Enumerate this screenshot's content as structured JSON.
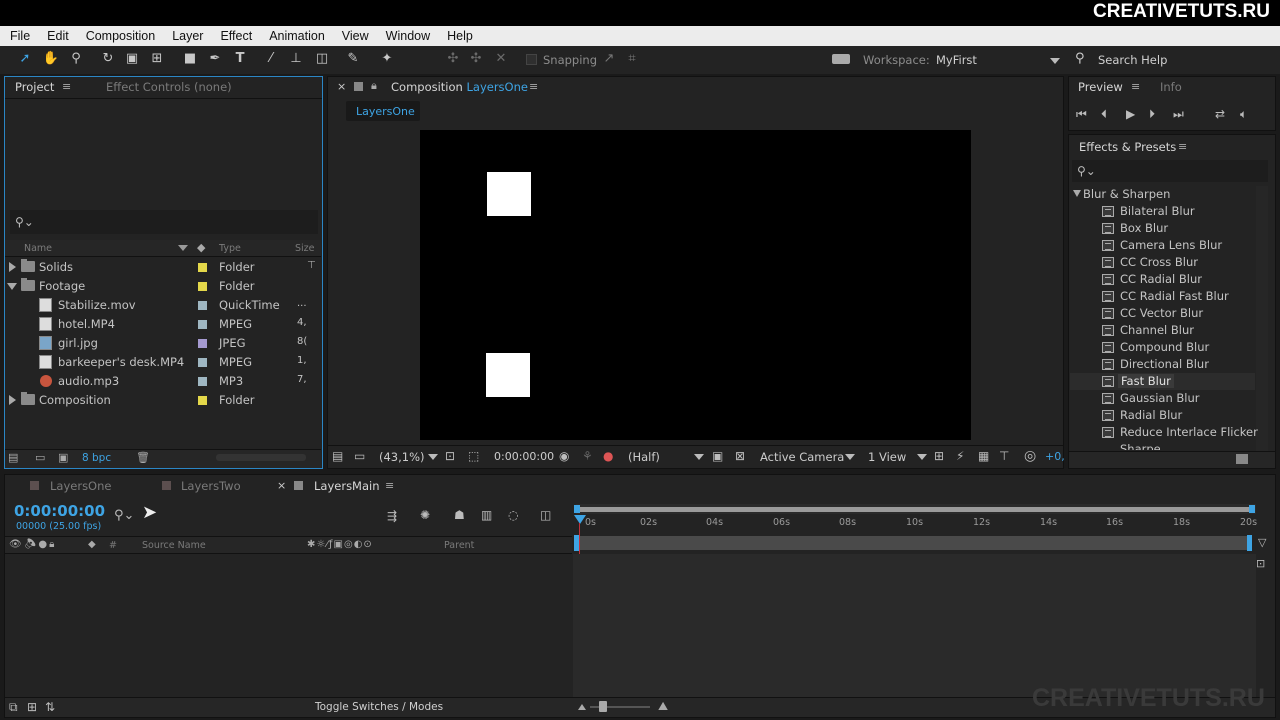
{
  "brand": "CREATIVETUTS.RU",
  "watermark": "CREATIVETUTS.RU",
  "menu": [
    "File",
    "Edit",
    "Composition",
    "Layer",
    "Effect",
    "Animation",
    "View",
    "Window",
    "Help"
  ],
  "toolbar": {
    "snapping": "Snapping",
    "workspace_label": "Workspace:",
    "workspace_value": "MyFirst",
    "search_help": "Search Help"
  },
  "project_panel": {
    "tab_project": "Project",
    "tab_effect_controls": "Effect Controls (none)",
    "col_name": "Name",
    "col_type": "Type",
    "col_size": "Size",
    "bpc": "8 bpc",
    "items": [
      {
        "name": "Solids",
        "type": "Folder",
        "size": "",
        "color": "#e4d84a"
      },
      {
        "name": "Footage",
        "type": "Folder",
        "size": "",
        "color": "#e4d84a"
      },
      {
        "name": "Stabilize.mov",
        "type": "QuickTime",
        "size": "...",
        "color": "#9fb7c2"
      },
      {
        "name": "hotel.MP4",
        "type": "MPEG",
        "size": "4,",
        "color": "#9fb7c2"
      },
      {
        "name": "girl.jpg",
        "type": "JPEG",
        "size": "8(",
        "color": "#a59ad0"
      },
      {
        "name": "barkeeper's desk.MP4",
        "type": "MPEG",
        "size": "1,",
        "color": "#9fb7c2"
      },
      {
        "name": "audio.mp3",
        "type": "MP3",
        "size": "7,",
        "color": "#9fb7c2"
      },
      {
        "name": "Composition",
        "type": "Folder",
        "size": "",
        "color": "#e4d84a"
      }
    ]
  },
  "composition_panel": {
    "title_prefix": "Composition",
    "title_name": "LayersOne",
    "tab": "LayersOne",
    "zoom": "(43,1%)",
    "timecode": "0:00:00:00",
    "resolution": "(Half)",
    "camera": "Active Camera",
    "view": "1 View",
    "exposure": "+0,"
  },
  "preview_panel": {
    "tab_preview": "Preview",
    "tab_info": "Info"
  },
  "effects_panel": {
    "title": "Effects & Presets",
    "category": "Blur & Sharpen",
    "selected": "Fast Blur",
    "items": [
      "Bilateral Blur",
      "Box Blur",
      "Camera Lens Blur",
      "CC Cross Blur",
      "CC Radial Blur",
      "CC Radial Fast Blur",
      "CC Vector Blur",
      "Channel Blur",
      "Compound Blur",
      "Directional Blur",
      "Fast Blur",
      "Gaussian Blur",
      "Radial Blur",
      "Reduce Interlace Flicker",
      "Sharpen"
    ]
  },
  "timeline": {
    "tabs": [
      "LayersOne",
      "LayersTwo",
      "LayersMain"
    ],
    "active_tab": "LayersMain",
    "timecode": "0:00:00:00",
    "frames": "00000 (25.00 fps)",
    "col_source": "Source Name",
    "col_parent": "Parent",
    "col_num": "#",
    "ruler": [
      "0s",
      "02s",
      "04s",
      "06s",
      "08s",
      "10s",
      "12s",
      "14s",
      "16s",
      "18s",
      "20s"
    ],
    "toggle_label": "Toggle Switches / Modes"
  }
}
